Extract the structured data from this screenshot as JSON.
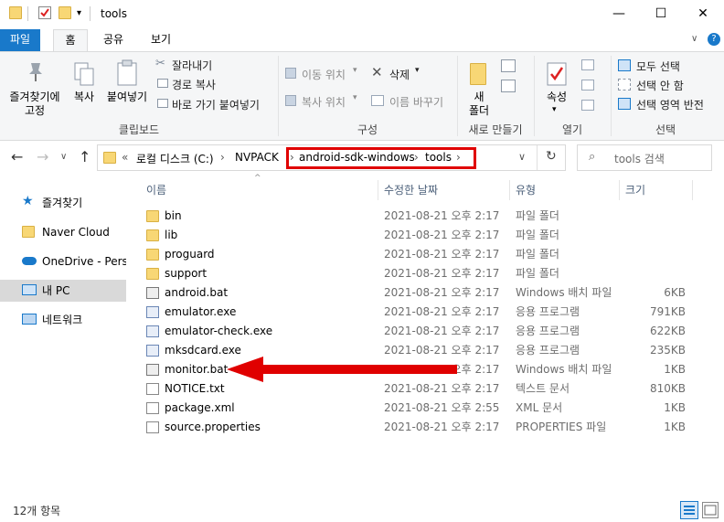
{
  "window": {
    "title": "tools",
    "minimize": "—",
    "maximize": "☐",
    "close": "✕"
  },
  "tabs": [
    "파일",
    "홈",
    "공유",
    "보기"
  ],
  "ribbon": {
    "clipboard": {
      "pin": "즐겨찾기에\n고정",
      "copy": "복사",
      "paste": "붙여넣기",
      "cut": "잘라내기",
      "copy_path": "경로 복사",
      "paste_shortcut": "바로 가기 붙여넣기",
      "label": "클립보드"
    },
    "organize": {
      "move_to": "이동 위치",
      "copy_to": "복사 위치",
      "delete": "삭제",
      "rename": "이름 바꾸기",
      "label": "구성"
    },
    "new": {
      "new_folder": "새\n폴더",
      "label": "새로 만들기"
    },
    "open": {
      "properties": "속성",
      "label": "열기"
    },
    "select": {
      "select_all": "모두 선택",
      "select_none": "선택 안 함",
      "invert": "선택 영역 반전",
      "label": "선택"
    }
  },
  "address": {
    "overflow": "«",
    "crumbs": [
      "로컬 디스크 (C:)",
      "NVPACK",
      "android-sdk-windows",
      "tools"
    ],
    "sep": "›"
  },
  "search": {
    "placeholder": "tools 검색"
  },
  "nav": [
    {
      "label": "즐겨찾기",
      "icon": "star-icon"
    },
    {
      "label": "Naver Cloud",
      "icon": "cloud-folder-icon"
    },
    {
      "label": "OneDrive - Perso",
      "icon": "onedrive-icon"
    },
    {
      "label": "내 PC",
      "icon": "pc-icon"
    },
    {
      "label": "네트워크",
      "icon": "network-icon"
    }
  ],
  "columns": [
    "이름",
    "수정한 날짜",
    "유형",
    "크기"
  ],
  "files": [
    {
      "name": "bin",
      "date": "2021-08-21 오후 2:17",
      "type": "파일 폴더",
      "size": "",
      "kind": "folder"
    },
    {
      "name": "lib",
      "date": "2021-08-21 오후 2:17",
      "type": "파일 폴더",
      "size": "",
      "kind": "folder"
    },
    {
      "name": "proguard",
      "date": "2021-08-21 오후 2:17",
      "type": "파일 폴더",
      "size": "",
      "kind": "folder"
    },
    {
      "name": "support",
      "date": "2021-08-21 오후 2:17",
      "type": "파일 폴더",
      "size": "",
      "kind": "folder"
    },
    {
      "name": "android.bat",
      "date": "2021-08-21 오후 2:17",
      "type": "Windows 배치 파일",
      "size": "6KB",
      "kind": "bat"
    },
    {
      "name": "emulator.exe",
      "date": "2021-08-21 오후 2:17",
      "type": "응용 프로그램",
      "size": "791KB",
      "kind": "exe"
    },
    {
      "name": "emulator-check.exe",
      "date": "2021-08-21 오후 2:17",
      "type": "응용 프로그램",
      "size": "622KB",
      "kind": "exe"
    },
    {
      "name": "mksdcard.exe",
      "date": "2021-08-21 오후 2:17",
      "type": "응용 프로그램",
      "size": "235KB",
      "kind": "exe"
    },
    {
      "name": "monitor.bat",
      "date": "2021-08-21 오후 2:17",
      "type": "Windows 배치 파일",
      "size": "1KB",
      "kind": "bat"
    },
    {
      "name": "NOTICE.txt",
      "date": "2021-08-21 오후 2:17",
      "type": "텍스트 문서",
      "size": "810KB",
      "kind": "doc"
    },
    {
      "name": "package.xml",
      "date": "2021-08-21 오후 2:55",
      "type": "XML 문서",
      "size": "1KB",
      "kind": "doc"
    },
    {
      "name": "source.properties",
      "date": "2021-08-21 오후 2:17",
      "type": "PROPERTIES 파일",
      "size": "1KB",
      "kind": "doc"
    }
  ],
  "status": {
    "count": "12개 항목"
  },
  "colors": {
    "accent": "#1979ca",
    "highlight": "#e00000",
    "folder": "#f8d775"
  }
}
